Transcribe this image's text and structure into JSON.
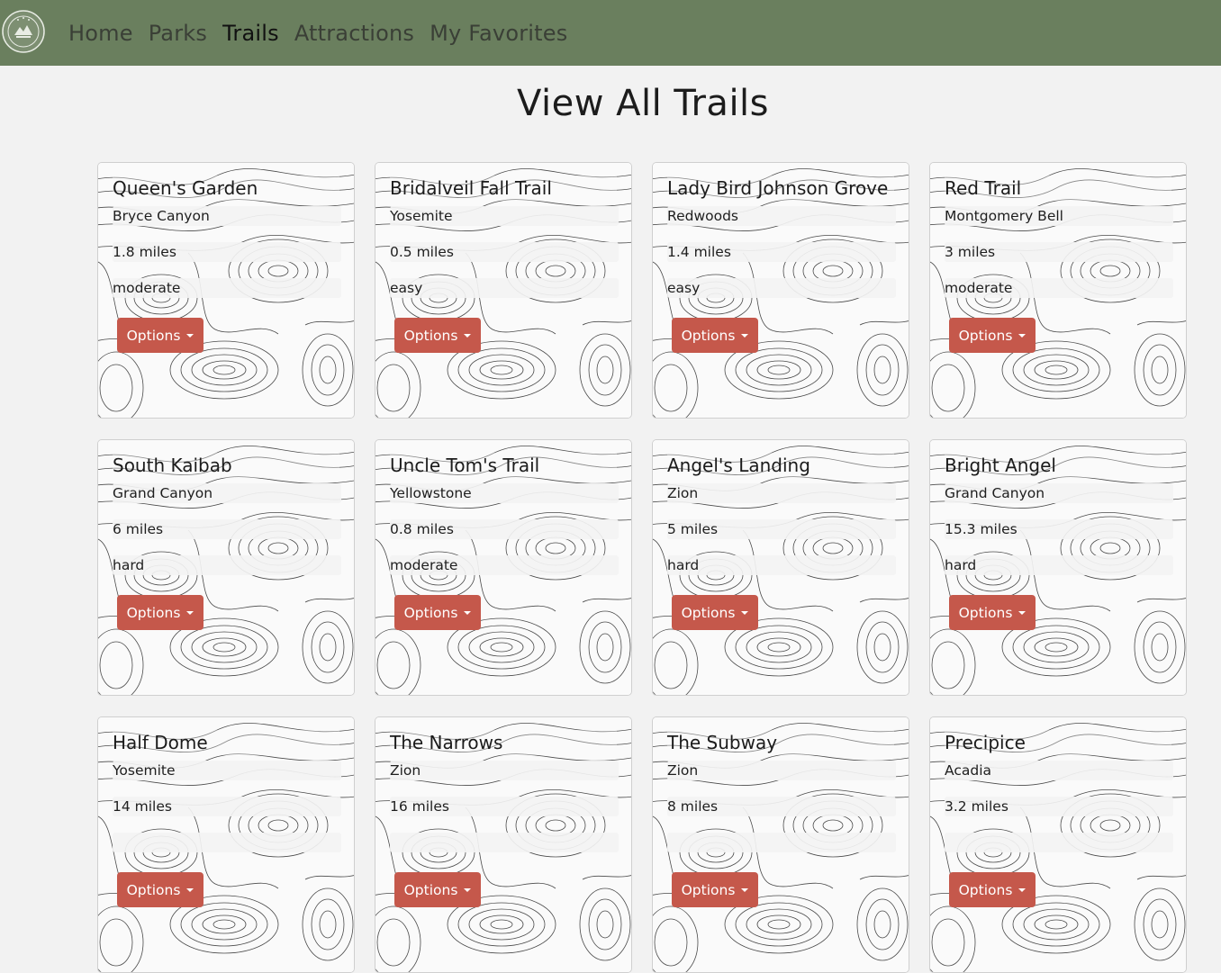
{
  "nav": {
    "logo_icon": "park-seal-logo-icon",
    "links": [
      {
        "label": "Home"
      },
      {
        "label": "Parks"
      },
      {
        "label": "Trails",
        "active": true
      },
      {
        "label": "Attractions"
      },
      {
        "label": "My Favorites"
      }
    ],
    "bg_color": "#6a7f5e"
  },
  "page": {
    "title": "View All Trails"
  },
  "colors": {
    "button": "#c5584b",
    "background": "#f2f2f2"
  },
  "trails": [
    {
      "name": "Queen's Garden",
      "park": "Bryce Canyon",
      "length": "1.8 miles",
      "difficulty": "moderate",
      "button": "Options"
    },
    {
      "name": "Bridalveil Fall Trail",
      "park": "Yosemite",
      "length": "0.5 miles",
      "difficulty": "easy",
      "button": "Options"
    },
    {
      "name": "Lady Bird Johnson Grove",
      "park": "Redwoods",
      "length": "1.4 miles",
      "difficulty": "easy",
      "button": "Options"
    },
    {
      "name": "Red Trail",
      "park": "Montgomery Bell",
      "length": "3 miles",
      "difficulty": "moderate",
      "button": "Options"
    },
    {
      "name": "South Kaibab",
      "park": "Grand Canyon",
      "length": "6 miles",
      "difficulty": "hard",
      "button": "Options"
    },
    {
      "name": "Uncle Tom's Trail",
      "park": "Yellowstone",
      "length": "0.8 miles",
      "difficulty": "moderate",
      "button": "Options"
    },
    {
      "name": "Angel's Landing",
      "park": "Zion",
      "length": "5 miles",
      "difficulty": "hard",
      "button": "Options"
    },
    {
      "name": "Bright Angel",
      "park": "Grand Canyon",
      "length": "15.3 miles",
      "difficulty": "hard",
      "button": "Options"
    },
    {
      "name": "Half Dome",
      "park": "Yosemite",
      "length": "14 miles",
      "difficulty": "",
      "button": "Options"
    },
    {
      "name": "The Narrows",
      "park": "Zion",
      "length": "16 miles",
      "difficulty": "",
      "button": "Options"
    },
    {
      "name": "The Subway",
      "park": "Zion",
      "length": "8 miles",
      "difficulty": "",
      "button": "Options"
    },
    {
      "name": "Precipice",
      "park": "Acadia",
      "length": "3.2 miles",
      "difficulty": "",
      "button": "Options"
    }
  ]
}
